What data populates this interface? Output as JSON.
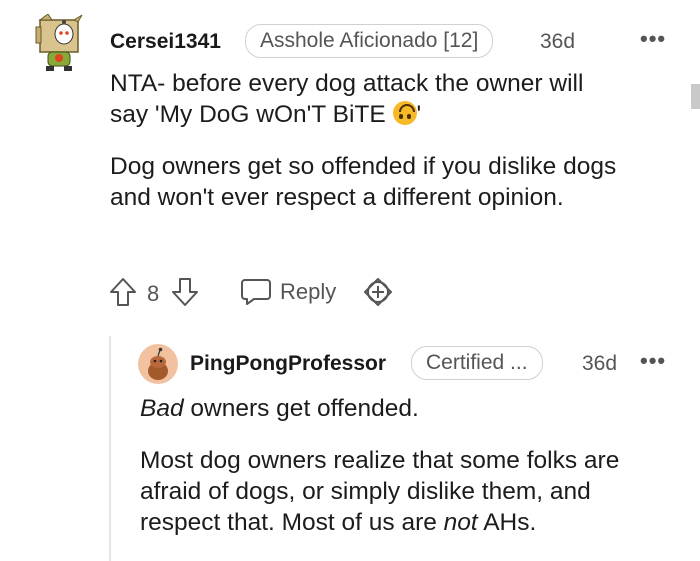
{
  "comment": {
    "username": "Cersei1341",
    "flair": "Asshole Aficionado [12]",
    "age": "36d",
    "more": "•••",
    "body": {
      "line1": "NTA- before every dog attack the owner will",
      "line2_prefix": "say 'My DoG wOn'T BiTE ",
      "line2_suffix": "'",
      "para2": "Dog owners get so offended if you dislike dogs and won't ever respect a different opinion."
    },
    "vote_count": "8",
    "reply_label": "Reply"
  },
  "reply": {
    "username": "PingPongProfessor",
    "flair": "Certified ...",
    "age": "36d",
    "more": "•••",
    "para1_em": "Bad",
    "para1_rest": " owners get offended.",
    "para2_before": "Most dog owners realize that some folks are afraid of dogs, or simply dislike them, and respect that. Most of us are ",
    "para2_em": "not",
    "para2_after": " AHs."
  },
  "colors": {
    "text": "#1c1c1c",
    "meta": "#555555",
    "flair_border": "#d0d0d0",
    "thread_line": "#e5e5e5"
  },
  "icons": {
    "upvote": "arrow-up-outline-icon",
    "downvote": "arrow-down-outline-icon",
    "reply": "speech-bubble-icon",
    "award": "plus-circle-award-icon",
    "more": "three-dots-icon"
  }
}
